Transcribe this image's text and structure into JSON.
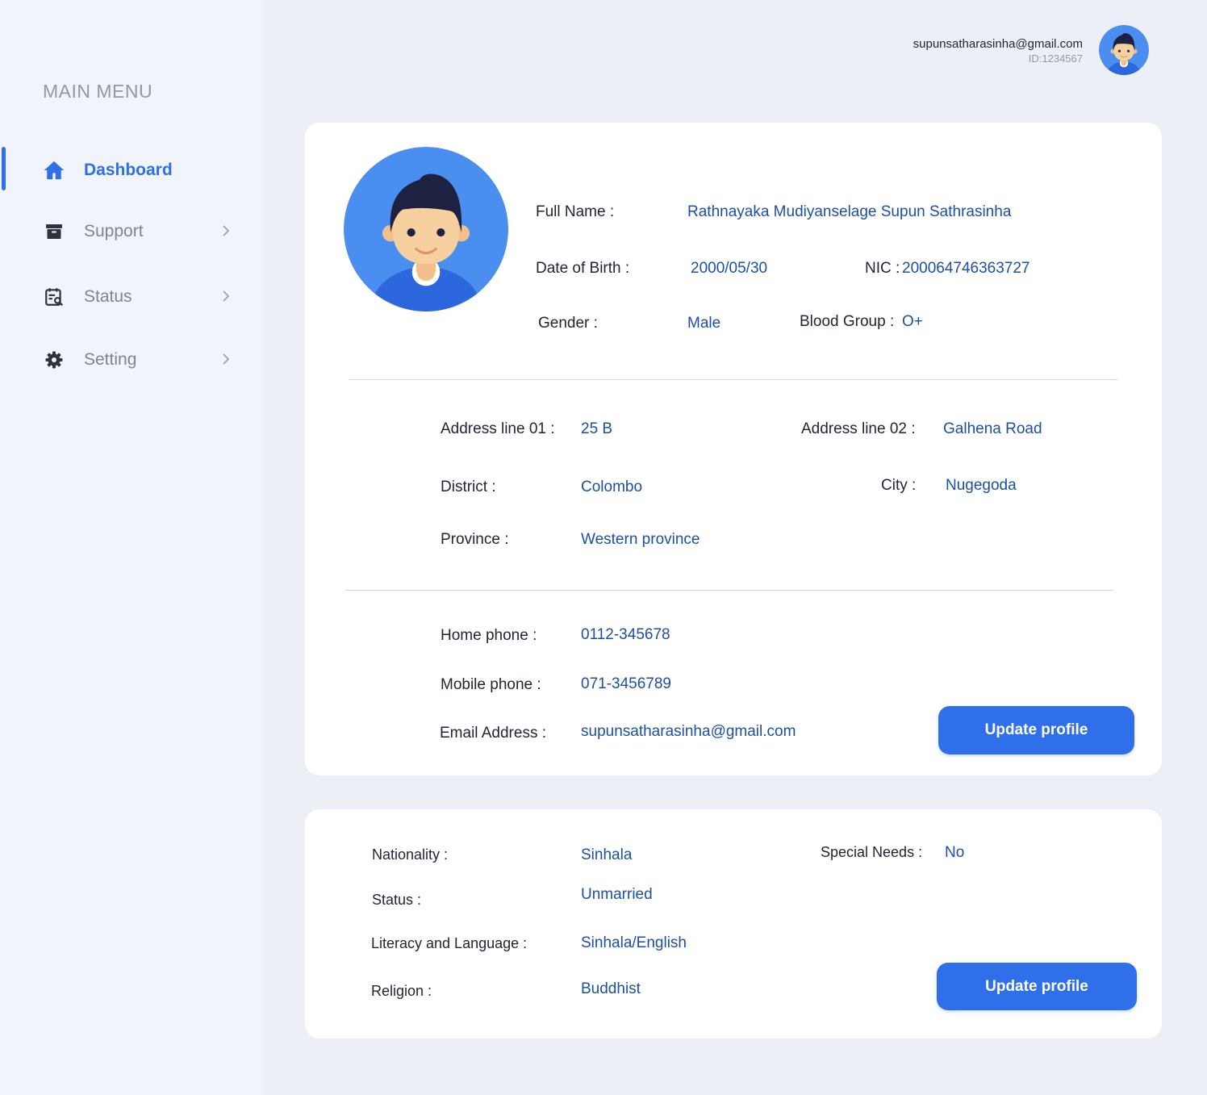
{
  "sidebar": {
    "title": "MAIN MENU",
    "items": [
      {
        "label": "Dashboard",
        "icon": "home-icon"
      },
      {
        "label": "Support",
        "icon": "archive-icon"
      },
      {
        "label": "Status",
        "icon": "calendar-search-icon"
      },
      {
        "label": "Setting",
        "icon": "gear-icon"
      }
    ]
  },
  "header": {
    "email": "supunsatharasinha@gmail.com",
    "id": "ID:1234567"
  },
  "profile": {
    "full_name_label": "Full Name  :",
    "full_name": "Rathnayaka Mudiyanselage Supun Sathrasinha",
    "dob_label": "Date of Birth  :",
    "dob": "2000/05/30",
    "nic_label": "NIC  :",
    "nic": "200064746363727",
    "gender_label": "Gender  :",
    "gender": "Male",
    "blood_label": "Blood Group  :",
    "blood": "O+"
  },
  "address": {
    "line1_label": "Address line 01  :",
    "line1": "25 B",
    "line2_label": "Address line 02  :",
    "line2": "Galhena Road",
    "district_label": "District  :",
    "district": "Colombo",
    "city_label": "City  :",
    "city": "Nugegoda",
    "province_label": "Province  :",
    "province": "Western province"
  },
  "contact": {
    "home_label": "Home phone  :",
    "home": "0112-345678",
    "mobile_label": "Mobile phone  :",
    "mobile": "071-3456789",
    "email_label": "Email Address  :",
    "email": "supunsatharasinha@gmail.com",
    "update_label": "Update profile"
  },
  "personal": {
    "nationality_label": "Nationality  :",
    "nationality": "Sinhala",
    "special_label": "Special Needs  :",
    "special": "No",
    "status_label": "Status  :",
    "status": "Unmarried",
    "literacy_label": "Literacy and Language  :",
    "literacy": "Sinhala/English",
    "religion_label": "Religion  :",
    "religion": "Buddhist",
    "update_label": "Update profile"
  },
  "colors": {
    "accent": "#2f6fea",
    "value_text": "#1d4fa3",
    "background": "#ecf0f6",
    "sidebar": "#f1f5fb"
  }
}
